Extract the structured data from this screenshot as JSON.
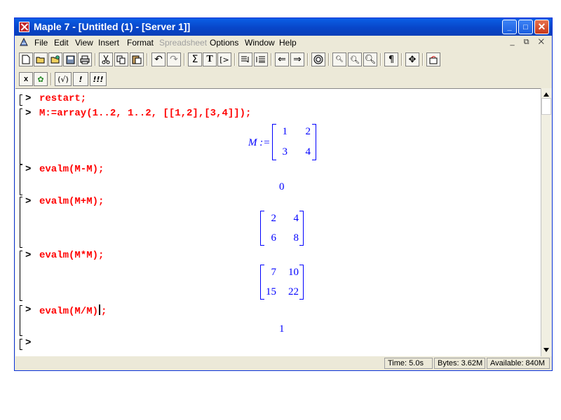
{
  "window": {
    "title": "Maple 7  - [Untitled (1) - [Server 1]]"
  },
  "menu": [
    "File",
    "Edit",
    "View",
    "Insert",
    "Format",
    "Spreadsheet",
    "Options",
    "Window",
    "Help"
  ],
  "menu_disabled": "Spreadsheet",
  "toolbar2": {
    "x_label": "x",
    "check_label": "(√)",
    "bang_label": "!",
    "bang3_label": "!!!"
  },
  "worksheet": {
    "prompt": ">",
    "inputs": {
      "restart": "restart;",
      "array": "M:=array(1..2, 1..2, [[1,2],[3,4]]);",
      "minus": "evalm(M-M);",
      "plus": "evalm(M+M);",
      "times": "evalm(M*M);",
      "divide_a": "evalm(M/M)",
      "divide_b": ";"
    },
    "outputs": {
      "assign_label": "M :=",
      "M": [
        [
          "1",
          "2"
        ],
        [
          "3",
          "4"
        ]
      ],
      "minus": "0",
      "plus": [
        [
          "2",
          "4"
        ],
        [
          "6",
          "8"
        ]
      ],
      "times": [
        [
          "7",
          "10"
        ],
        [
          "15",
          "22"
        ]
      ],
      "divide": "1"
    }
  },
  "status": {
    "time": "Time:  5.0s",
    "bytes": "Bytes: 3.62M",
    "available": "Available: 840M"
  }
}
